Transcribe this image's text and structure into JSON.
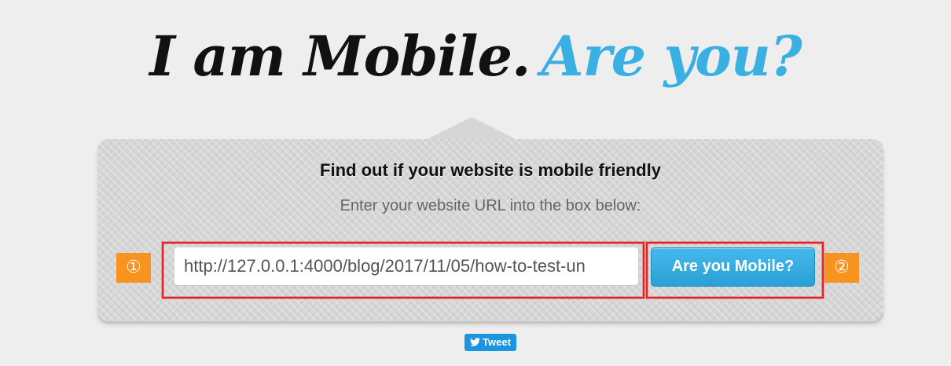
{
  "hero": {
    "title_part1": "I am Mobile.",
    "title_part2": "Are you?"
  },
  "panel": {
    "heading": "Find out if your website is mobile friendly",
    "subheading": "Enter your website URL into the box below:",
    "url_value": "http://127.0.0.1:4000/blog/2017/11/05/how-to-test-un",
    "button_label": "Are you Mobile?",
    "markers": [
      "①",
      "②"
    ]
  },
  "tweet": {
    "label": "Tweet",
    "icon": "twitter-bird-icon"
  },
  "colors": {
    "background": "#eeeeee",
    "accent_blue": "#3ab0e2",
    "button_blue": "#2aa0d6",
    "marker_orange": "#f7931e",
    "highlight_red": "#e52222",
    "tweet_blue": "#1b95e0"
  }
}
